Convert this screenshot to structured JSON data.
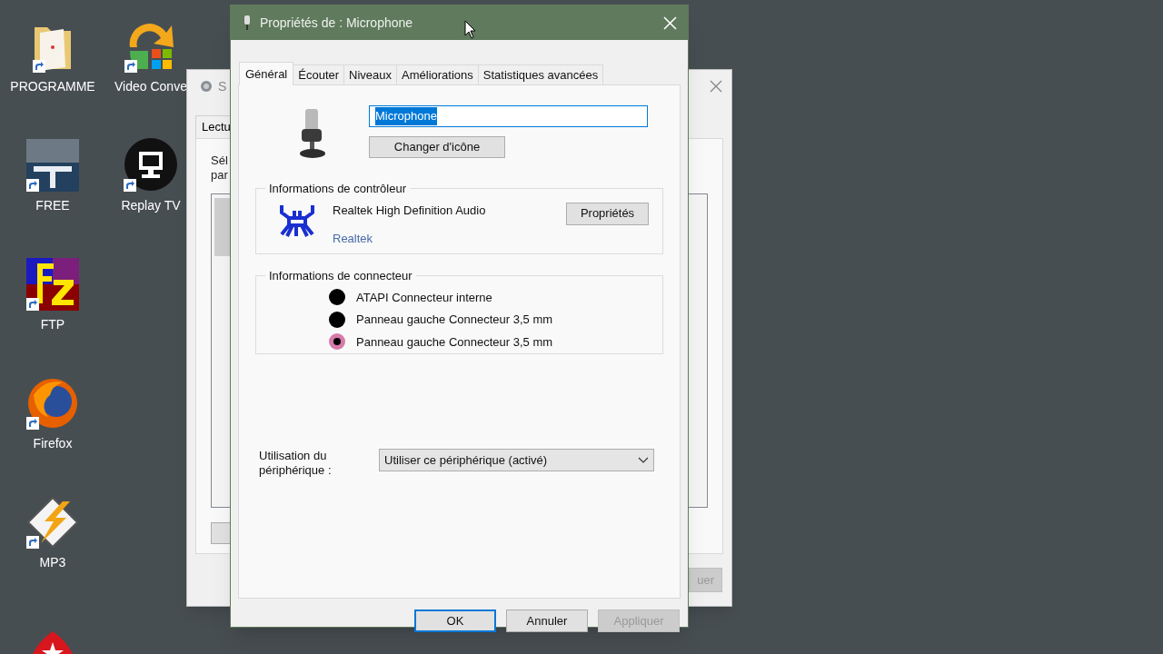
{
  "desktop_icons": [
    {
      "kind": "folder",
      "label": "PROGRAMME"
    },
    {
      "kind": "tv",
      "label": "FREE"
    },
    {
      "kind": "ftp",
      "label": "FTP"
    },
    {
      "kind": "browser",
      "label": "Firefox"
    },
    {
      "kind": "player",
      "label": "MP3"
    },
    {
      "kind": "star"
    },
    {
      "kind": "converter",
      "label": "Video Conve"
    },
    {
      "kind": "monitor",
      "label": "Replay TV"
    }
  ],
  "background_window": {
    "title": "S",
    "tab": "Lectu",
    "text_lines": [
      "Sél",
      "par"
    ],
    "button": "uer"
  },
  "dialog": {
    "title": "Propriétés de : Microphone",
    "tabs": [
      {
        "label": "Général",
        "selected": true
      },
      {
        "label": "Écouter",
        "selected": false
      },
      {
        "label": "Niveaux",
        "selected": false
      },
      {
        "label": "Améliorations",
        "selected": false
      },
      {
        "label": "Statistiques avancées",
        "selected": false
      }
    ],
    "name_field": {
      "value": "Microphone",
      "text_selected": true
    },
    "change_icon_button": "Changer d'icône",
    "controller": {
      "title": "Informations de contrôleur",
      "name": "Realtek High Definition Audio",
      "link": "Realtek",
      "button": "Propriétés"
    },
    "connector": {
      "title": "Informations de connecteur",
      "jacks": [
        {
          "label": "ATAPI Connecteur interne",
          "color": "#000000"
        },
        {
          "label": "Panneau gauche Connecteur 3,5 mm",
          "color": "#000000"
        },
        {
          "label": "Panneau gauche Connecteur 3,5 mm",
          "color": "#d77aa9"
        }
      ]
    },
    "usage": {
      "label": "Utilisation du périphérique :",
      "value": "Utiliser ce périphérique (activé)"
    },
    "buttons": [
      {
        "label": "OK",
        "default": true,
        "disabled": false
      },
      {
        "label": "Annuler",
        "default": false,
        "disabled": false
      },
      {
        "label": "Appliquer",
        "default": false,
        "disabled": true
      }
    ]
  }
}
